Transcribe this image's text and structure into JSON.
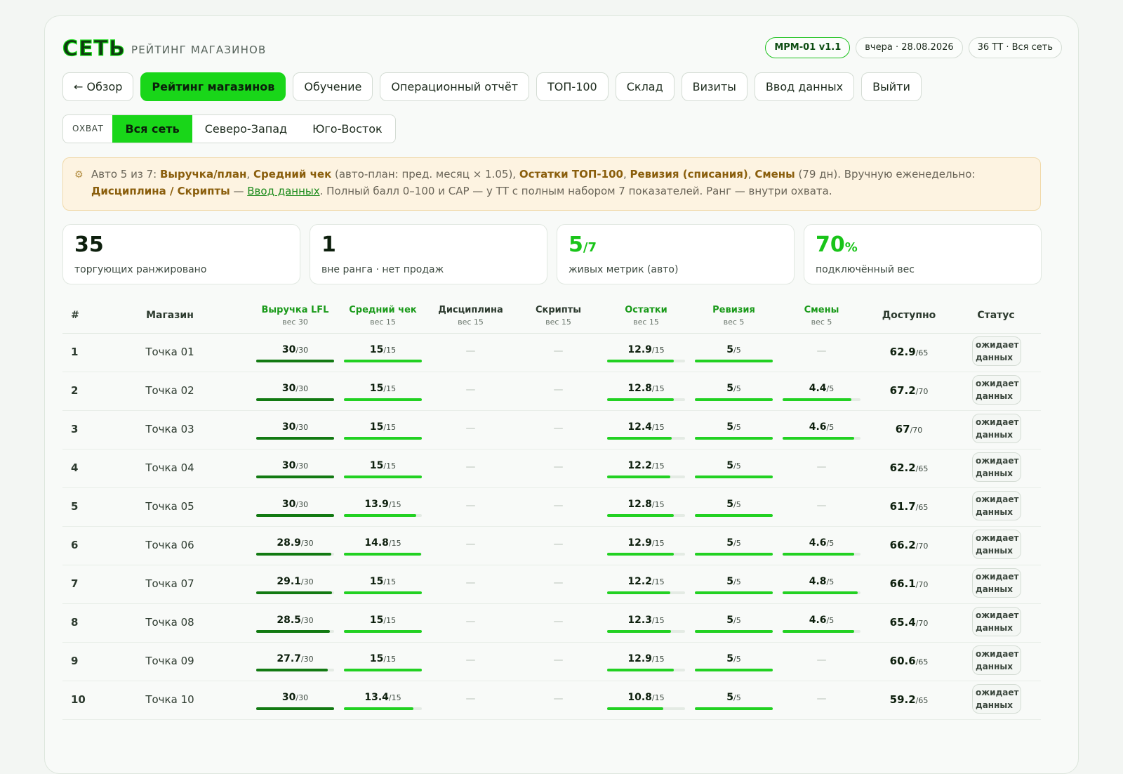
{
  "header": {
    "logo": "СЕТЬ",
    "subtitle": "РЕЙТИНГ МАГАЗИНОВ",
    "version": "МРМ-01 v1.1",
    "date": "вчера · 28.08.2026",
    "scope_info": "36 ТТ · Вся сеть"
  },
  "nav": [
    {
      "label": "← Обзор",
      "active": false
    },
    {
      "label": "Рейтинг магазинов",
      "active": true
    },
    {
      "label": "Обучение",
      "active": false
    },
    {
      "label": "Операционный отчёт",
      "active": false
    },
    {
      "label": "ТОП-100",
      "active": false
    },
    {
      "label": "Склад",
      "active": false
    },
    {
      "label": "Визиты",
      "active": false
    },
    {
      "label": "Ввод данных",
      "active": false
    },
    {
      "label": "Выйти",
      "active": false
    }
  ],
  "scope": {
    "label": "ОХВАТ",
    "items": [
      {
        "label": "Вся сеть",
        "active": true
      },
      {
        "label": "Северо-Запад",
        "active": false
      },
      {
        "label": "Юго-Восток",
        "active": false
      }
    ]
  },
  "notice": {
    "icon": "gear-icon",
    "t1": "Авто 5 из 7: ",
    "b1": "Выручка/план",
    "t2": ", ",
    "b2": "Средний чек",
    "t3": " (авто-план: пред. месяц × 1.05), ",
    "b3": "Остатки ТОП-100",
    "t4": ", ",
    "b4": "Ревизия (списания)",
    "t5": ", ",
    "b5": "Смены",
    "t6": " (79 дн). Вручную еженедельно: ",
    "b6": "Дисциплина / Скрипты",
    "t7": " — ",
    "link": "Ввод данных",
    "t8": ". Полный балл 0–100 и САР — у ТТ с полным набором 7 показателей. Ранг — внутри охвата."
  },
  "stats": [
    {
      "value": "35",
      "suffix": "",
      "label": "торгующих ранжировано",
      "green": false
    },
    {
      "value": "1",
      "suffix": "",
      "label": "вне ранга · нет продаж",
      "green": false
    },
    {
      "value": "5",
      "suffix": "/7",
      "label": "живых метрик (авто)",
      "green": true
    },
    {
      "value": "70",
      "suffix": "%",
      "label": "подключённый вес",
      "green": true
    }
  ],
  "table": {
    "col_rank": "#",
    "col_name": "Магазин",
    "col_avail": "Доступно",
    "col_status": "Статус",
    "metrics": [
      {
        "name": "Выручка LFL",
        "weight": "вес 30",
        "max": 30,
        "live": true
      },
      {
        "name": "Средний чек",
        "weight": "вес 15",
        "max": 15,
        "live": true
      },
      {
        "name": "Дисциплина",
        "weight": "вес 15",
        "max": 15,
        "live": false
      },
      {
        "name": "Скрипты",
        "weight": "вес 15",
        "max": 15,
        "live": false
      },
      {
        "name": "Остатки",
        "weight": "вес 15",
        "max": 15,
        "live": true
      },
      {
        "name": "Ревизия",
        "weight": "вес 5",
        "max": 5,
        "live": true
      },
      {
        "name": "Смены",
        "weight": "вес 5",
        "max": 5,
        "live": true
      }
    ],
    "dash": "—",
    "rows": [
      {
        "rank": "1",
        "name": "Точка 01",
        "m": [
          30,
          15,
          null,
          null,
          12.9,
          5,
          null
        ],
        "avail": "62.9",
        "avail_max": "/65",
        "status": "ожидает данных"
      },
      {
        "rank": "2",
        "name": "Точка 02",
        "m": [
          30,
          15,
          null,
          null,
          12.8,
          5,
          4.4
        ],
        "avail": "67.2",
        "avail_max": "/70",
        "status": "ожидает данных"
      },
      {
        "rank": "3",
        "name": "Точка 03",
        "m": [
          30,
          15,
          null,
          null,
          12.4,
          5,
          4.6
        ],
        "avail": "67",
        "avail_max": "/70",
        "status": "ожидает данных"
      },
      {
        "rank": "4",
        "name": "Точка 04",
        "m": [
          30,
          15,
          null,
          null,
          12.2,
          5,
          null
        ],
        "avail": "62.2",
        "avail_max": "/65",
        "status": "ожидает данных"
      },
      {
        "rank": "5",
        "name": "Точка 05",
        "m": [
          30,
          13.9,
          null,
          null,
          12.8,
          5,
          null
        ],
        "avail": "61.7",
        "avail_max": "/65",
        "status": "ожидает данных"
      },
      {
        "rank": "6",
        "name": "Точка 06",
        "m": [
          28.9,
          14.8,
          null,
          null,
          12.9,
          5,
          4.6
        ],
        "avail": "66.2",
        "avail_max": "/70",
        "status": "ожидает данных"
      },
      {
        "rank": "7",
        "name": "Точка 07",
        "m": [
          29.1,
          15,
          null,
          null,
          12.2,
          5,
          4.8
        ],
        "avail": "66.1",
        "avail_max": "/70",
        "status": "ожидает данных"
      },
      {
        "rank": "8",
        "name": "Точка 08",
        "m": [
          28.5,
          15,
          null,
          null,
          12.3,
          5,
          4.6
        ],
        "avail": "65.4",
        "avail_max": "/70",
        "status": "ожидает данных"
      },
      {
        "rank": "9",
        "name": "Точка 09",
        "m": [
          27.7,
          15,
          null,
          null,
          12.9,
          5,
          null
        ],
        "avail": "60.6",
        "avail_max": "/65",
        "status": "ожидает данных"
      },
      {
        "rank": "10",
        "name": "Точка 10",
        "m": [
          30,
          13.4,
          null,
          null,
          10.8,
          5,
          null
        ],
        "avail": "59.2",
        "avail_max": "/65",
        "status": "ожидает данных"
      }
    ]
  },
  "colors": {
    "accent": "#19d619",
    "bar_dark": "#127a12",
    "bar_bright": "#22d122",
    "notice_bg": "#fdf3e1"
  }
}
